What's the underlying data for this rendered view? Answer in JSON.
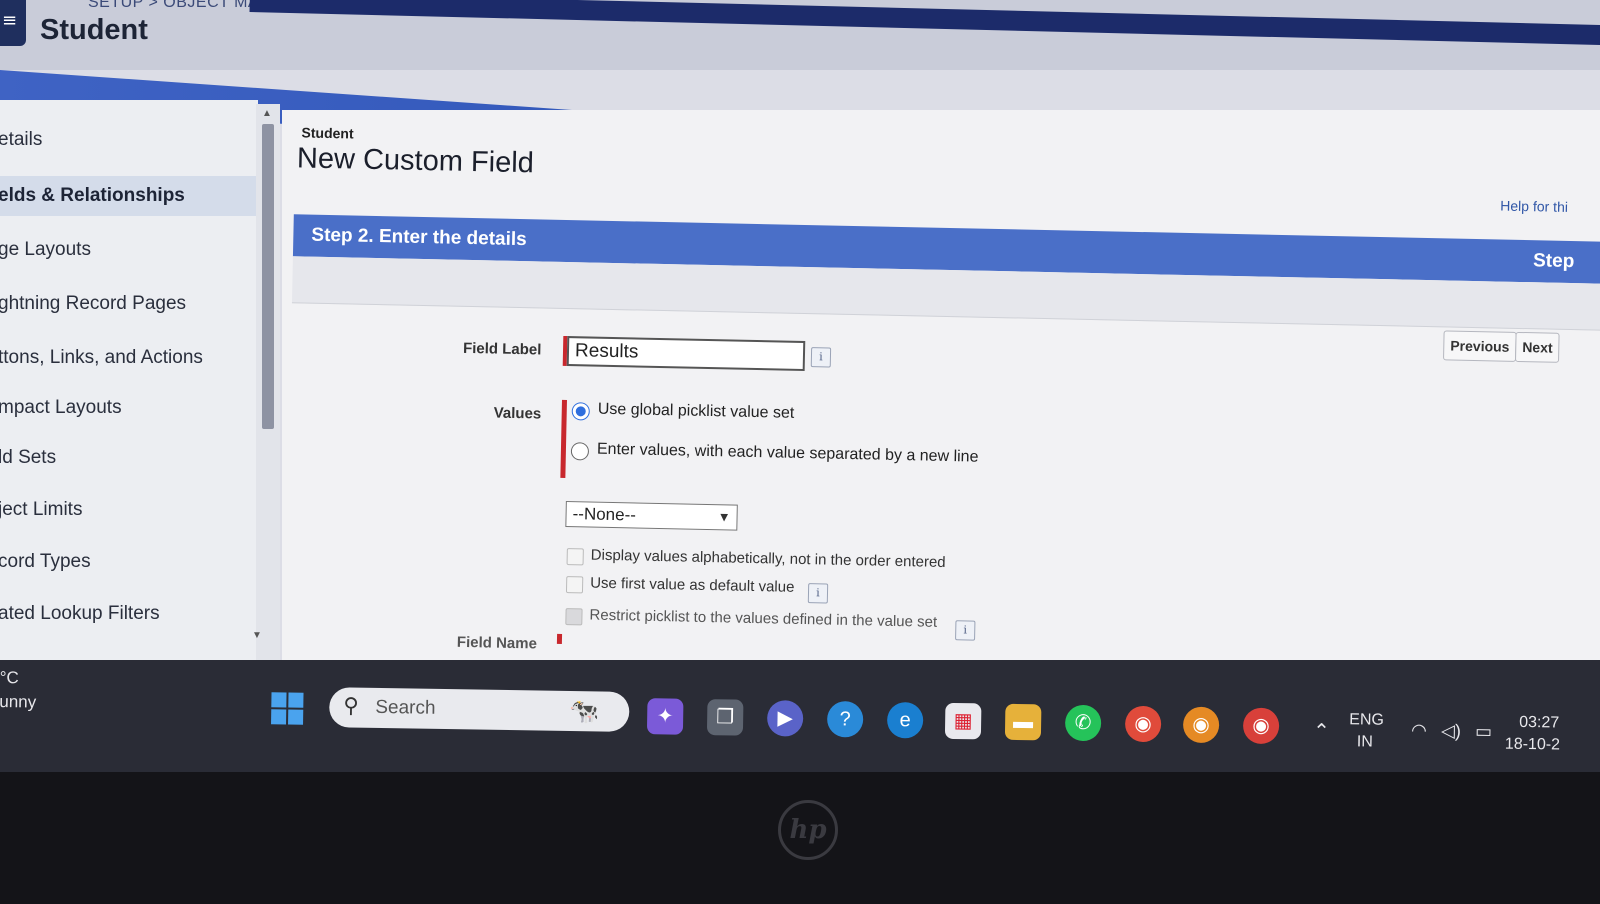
{
  "header": {
    "menu_glyph": "≡",
    "breadcrumb": "SETUP > OBJECT MANAGER",
    "object_title": "Student"
  },
  "sidebar": {
    "items": [
      {
        "label": "etails"
      },
      {
        "label": "elds & Relationships",
        "active": true
      },
      {
        "label": "ge Layouts"
      },
      {
        "label": "ghtning Record Pages"
      },
      {
        "label": "ttons, Links, and Actions"
      },
      {
        "label": "mpact Layouts"
      },
      {
        "label": "ld Sets"
      },
      {
        "label": "ject Limits"
      },
      {
        "label": "cord Types"
      },
      {
        "label": "ated Lookup Filters"
      }
    ]
  },
  "page": {
    "object_crumb": "Student",
    "title": "New Custom Field",
    "help_link": "Help for thi"
  },
  "step": {
    "title": "Step 2. Enter the details",
    "right_label": "Step",
    "previous_label": "Previous",
    "next_label": "Next"
  },
  "form": {
    "field_label_label": "Field Label",
    "field_label_value": "Results",
    "values_label": "Values",
    "radio_global": "Use global picklist value set",
    "radio_enter": "Enter values, with each value separated by a new line",
    "selected_radio": "global",
    "picklist_select_value": "--None--",
    "check_alpha": "Display values alphabetically, not in the order entered",
    "check_default": "Use first value as default value",
    "check_restrict": "Restrict picklist to the values defined in the value set",
    "field_name_label": "Field Name",
    "info_glyph": "i"
  },
  "taskbar": {
    "weather_temp": "°C",
    "weather_cond": "unny",
    "search_placeholder": "Search",
    "lang_top": "ENG",
    "lang_bottom": "IN",
    "time": "03:27",
    "date": "18-10-2"
  },
  "device": {
    "brand": "hp"
  },
  "colors": {
    "step_bar": "#4a6fc8",
    "required": "#c8282d",
    "radio_selected": "#2f6fde"
  }
}
